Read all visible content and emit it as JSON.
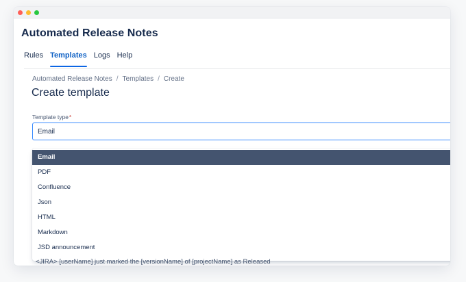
{
  "window": {
    "controls": [
      "close",
      "minimize",
      "zoom"
    ]
  },
  "app": {
    "title": "Automated Release Notes"
  },
  "tabs": [
    {
      "label": "Rules",
      "active": false
    },
    {
      "label": "Templates",
      "active": true
    },
    {
      "label": "Logs",
      "active": false
    },
    {
      "label": "Help",
      "active": false
    }
  ],
  "breadcrumb": {
    "items": [
      "Automated Release Notes",
      "Templates",
      "Create"
    ],
    "separator": "/"
  },
  "page": {
    "title": "Create template"
  },
  "template_type": {
    "label": "Template type",
    "required_marker": "*",
    "value": "Email",
    "options": [
      "Email",
      "PDF",
      "Confluence",
      "Json",
      "HTML",
      "Markdown",
      "JSD announcement"
    ],
    "selected_index": 0
  },
  "background_text": "<JIRA> [userName] just marked the [versionName] of [projectName] as Released",
  "colors": {
    "accent": "#0c66e4",
    "selected_option_bg": "#44546f",
    "text": "#172b4d"
  }
}
